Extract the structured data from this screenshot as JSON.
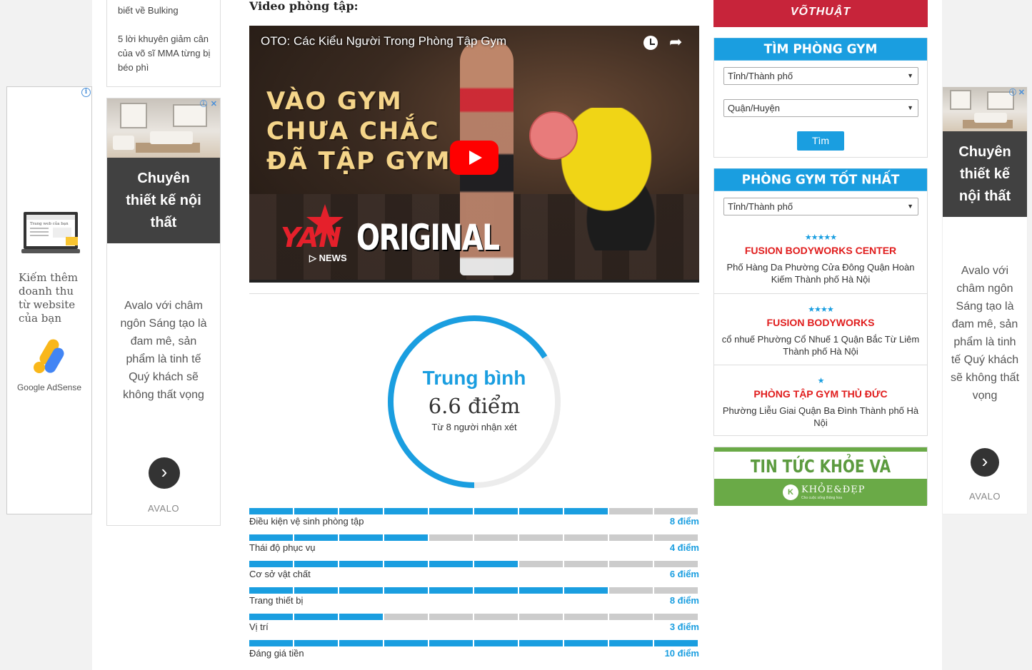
{
  "left_sidebar": {
    "related_posts": [
      "biết về Bulking",
      "5 lời khuyên giảm cân của võ sĩ MMA từng bị béo phì"
    ]
  },
  "ads": {
    "adsense": {
      "website_mock_text": "Trang web của bạn",
      "headline": "Kiếm thêm doanh thu từ website của bạn",
      "brand": "Google AdSense",
      "icon": "adchoices-icon"
    },
    "avalo": {
      "headline": "Chuyên thiết kế nội thất",
      "body": "Avalo với châm ngôn Sáng tạo là đam mê, sản phẩm là tinh tế Quý khách sẽ không thất vọng",
      "brand": "AVALO",
      "close_symbol": "✕",
      "arrow_symbol": "›"
    }
  },
  "main": {
    "video_heading": "Video phòng tập:",
    "video": {
      "title": "OTO: Các Kiểu Người Trong Phòng Tập Gym",
      "overlay_lines": [
        "VÀO GYM",
        "CHƯA CHẮC",
        "ĐÃ TẬP GYM"
      ],
      "channel_logo": "YAN",
      "channel_original": "ORIGINAL",
      "channel_news": "NEWS"
    },
    "rating": {
      "label": "Trung bình",
      "value_text": "6.6 điểm",
      "score": 6.6,
      "max": 10,
      "count_text": "Từ 8 người nhận xét"
    },
    "criteria": [
      {
        "name": "Điều kiện vệ sinh phòng tập",
        "score": 8,
        "label": "8 điểm"
      },
      {
        "name": "Thái độ phục vụ",
        "score": 4,
        "label": "4 điểm"
      },
      {
        "name": "Cơ sở vật chất",
        "score": 6,
        "label": "6 điểm"
      },
      {
        "name": "Trang thiết bị",
        "score": 8,
        "label": "8 điểm"
      },
      {
        "name": "Vị trí",
        "score": 3,
        "label": "3 điểm"
      },
      {
        "name": "Đáng giá tiền",
        "score": 10,
        "label": "10 điểm"
      }
    ]
  },
  "right_sidebar": {
    "banner": "VÕTHUẬT",
    "find_gym": {
      "title": "TÌM PHÒNG GYM",
      "province_select": "Tỉnh/Thành phố",
      "district_select": "Quận/Huyện",
      "button": "Tìm"
    },
    "best_gyms": {
      "title": "PHÒNG GYM TỐT NHẤT",
      "province_select": "Tỉnh/Thành phố",
      "items": [
        {
          "stars": 5,
          "star_text": "★★★★★",
          "name": "FUSION BODYWORKS CENTER",
          "address": "Phố Hàng Da Phường Cửa Đông Quận Hoàn Kiếm Thành phố Hà Nội"
        },
        {
          "stars": 4,
          "star_text": "★★★★",
          "name": "FUSION BODYWORKS",
          "address": "cổ nhuế Phường Cổ Nhuế 1 Quận Bắc Từ Liêm Thành phố Hà Nội"
        },
        {
          "stars": 1,
          "star_text": "★",
          "name": "PHÒNG TẬP GYM THỦ ĐỨC",
          "address": "Phường Liễu Giai Quận Ba Đình Thành phố Hà Nội"
        }
      ]
    },
    "health_banner": {
      "title": "TIN TỨC KHỎE VÀ ĐẸP",
      "brand": "KHỎE&ĐẸP",
      "tagline": "Cho cuộc sống thăng hoa"
    }
  },
  "colors": {
    "accent_blue": "#1a9ee0",
    "gym_red": "#e01c1c",
    "health_green": "#6aaa47",
    "vothuat_red": "#c7243a"
  }
}
